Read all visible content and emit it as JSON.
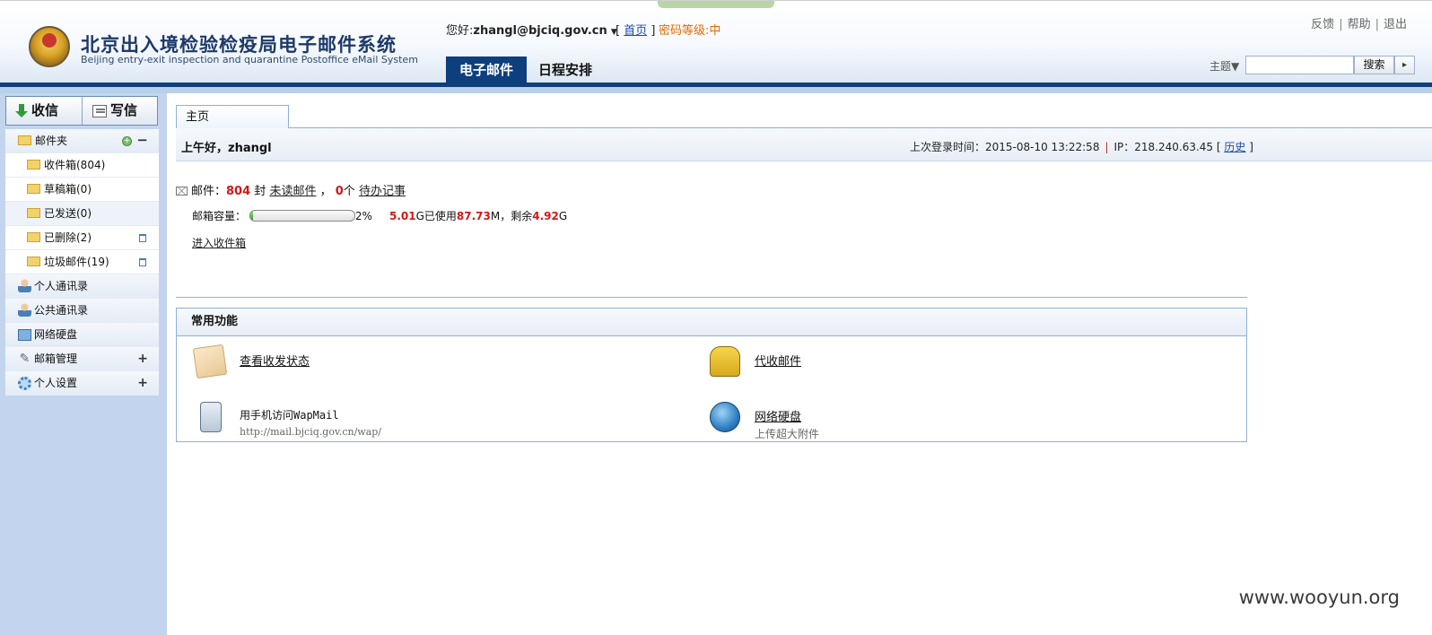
{
  "header": {
    "title_cn": "北京出入境检验检疫局电子邮件系统",
    "title_en": "Beijing entry-exit inspection and quarantine Postoffice eMail System",
    "greeting_prefix": "您好:",
    "user_email": "zhangl@bjciq.gov.cn",
    "home_link": "首页",
    "password_level": "密码等级:中",
    "top_links": [
      "反馈",
      "帮助",
      "退出"
    ],
    "nav_tabs": [
      "电子邮件",
      "日程安排"
    ],
    "subject_label": "主题▼",
    "search_placeholder": "",
    "search_button": "搜索",
    "search_arrow": "▸"
  },
  "sidebar": {
    "receive_label": "收信",
    "write_label": "写信",
    "folder_head": "邮件夹",
    "folders": [
      {
        "label": "收件箱(804)"
      },
      {
        "label": "草稿箱(0)"
      },
      {
        "label": "已发送(0)"
      },
      {
        "label": "已删除(2)"
      },
      {
        "label": "垃圾邮件(19)"
      }
    ],
    "sections": [
      "个人通讯录",
      "公共通讯录",
      "网络硬盘",
      "邮箱管理",
      "个人设置"
    ]
  },
  "main": {
    "tab_label": "主页",
    "welcome": "上午好，zhangl",
    "last_login_label": "上次登录时间：2015-08-10 13:22:58",
    "ip_label": "IP：218.240.63.45",
    "history_link": "历史",
    "mail_label": "邮件：",
    "mail_count": "804",
    "mail_unit": "封",
    "unread_link": "未读邮件",
    "todo_count": "0",
    "todo_unit": "个",
    "todo_link": "待办记事",
    "quota_label": "邮箱容量：",
    "quota_percent_text": "2%",
    "quota_fraction": 0.02,
    "quota_total": "5.01",
    "quota_total_unit": "G已使用",
    "quota_used": "87.73",
    "quota_used_unit": "M，剩余",
    "quota_remaining": "4.92",
    "quota_remaining_unit": "G",
    "inbox_link": "进入收件箱",
    "common_title": "常用功能",
    "functions": [
      {
        "label": "查看收发状态",
        "sub": ""
      },
      {
        "label": "代收邮件",
        "sub": ""
      },
      {
        "label": "用手机访问WapMail",
        "sub": "http://mail.bjciq.gov.cn/wap/"
      },
      {
        "label": "网络硬盘",
        "sub": "上传超大附件"
      }
    ]
  },
  "watermark": "www.wooyun.org"
}
